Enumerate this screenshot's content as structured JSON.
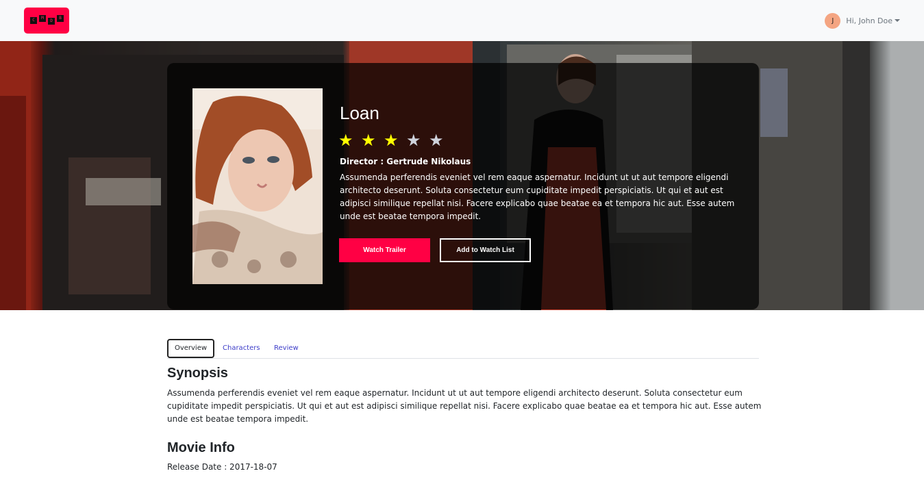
{
  "navbar": {
    "logo_letters": [
      "C",
      "M",
      "D",
      "B"
    ],
    "user_initial": "J",
    "user_greeting": "Hi, John Doe"
  },
  "movie": {
    "title": "Loan",
    "rating": 3,
    "max_rating": 5,
    "star_colors": {
      "filled": "#ffff00",
      "empty": "#cfd3dc"
    },
    "director": "Director : Gertrude Nikolaus",
    "description": "Assumenda perferendis eveniet vel rem eaque aspernatur. Incidunt ut ut aut tempore eligendi architecto deserunt. Soluta consectetur eum cupiditate impedit perspiciatis. Ut qui et aut est adipisci similique repellat nisi. Facere explicabo quae beatae ea et tempora hic aut. Esse autem unde est beatae tempora impedit.",
    "watch_trailer_label": "Watch Trailer",
    "add_watchlist_label": "Add to Watch List"
  },
  "tabs": [
    {
      "label": "Overview",
      "active": true
    },
    {
      "label": "Characters",
      "active": false
    },
    {
      "label": "Review",
      "active": false
    }
  ],
  "overview": {
    "synopsis_heading": "Synopsis",
    "synopsis_text": "Assumenda perferendis eveniet vel rem eaque aspernatur. Incidunt ut ut aut tempore eligendi architecto deserunt. Soluta consectetur eum cupiditate impedit perspiciatis. Ut qui et aut est adipisci similique repellat nisi. Facere explicabo quae beatae ea et tempora hic aut. Esse autem unde est beatae tempora impedit.",
    "info_heading": "Movie Info",
    "release_date": "Release Date : 2017-18-07"
  },
  "colors": {
    "brand": "#ff0044",
    "tab_link": "#3c3cc8"
  }
}
